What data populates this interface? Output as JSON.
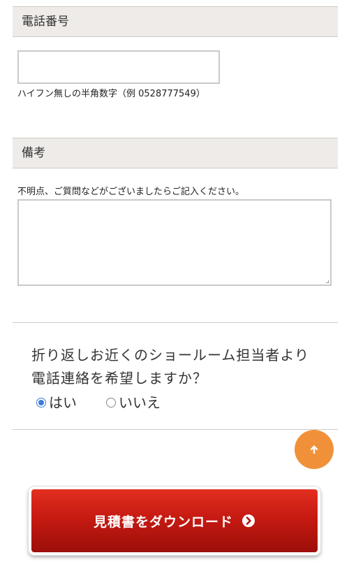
{
  "phone_section": {
    "title": "電話番号",
    "input_value": "",
    "hint": "ハイフン無しの半角数字（例 0528777549）"
  },
  "notes_section": {
    "title": "備考",
    "hint": "不明点、ご質問などがございましたらご記入ください。",
    "textarea_value": ""
  },
  "callback": {
    "question_line1": "折り返しお近くのショールーム担当者より",
    "question_line2": "電話連絡を希望しますか？",
    "options": [
      {
        "label": "はい",
        "selected": true
      },
      {
        "label": "いいえ",
        "selected": false
      }
    ]
  },
  "scroll_top": {
    "icon": "arrow-up-icon",
    "color": "#f0913a"
  },
  "download_button": {
    "label": "見積書をダウンロード",
    "icon": "chevron-right-circle-icon",
    "color": "#c61a12"
  }
}
